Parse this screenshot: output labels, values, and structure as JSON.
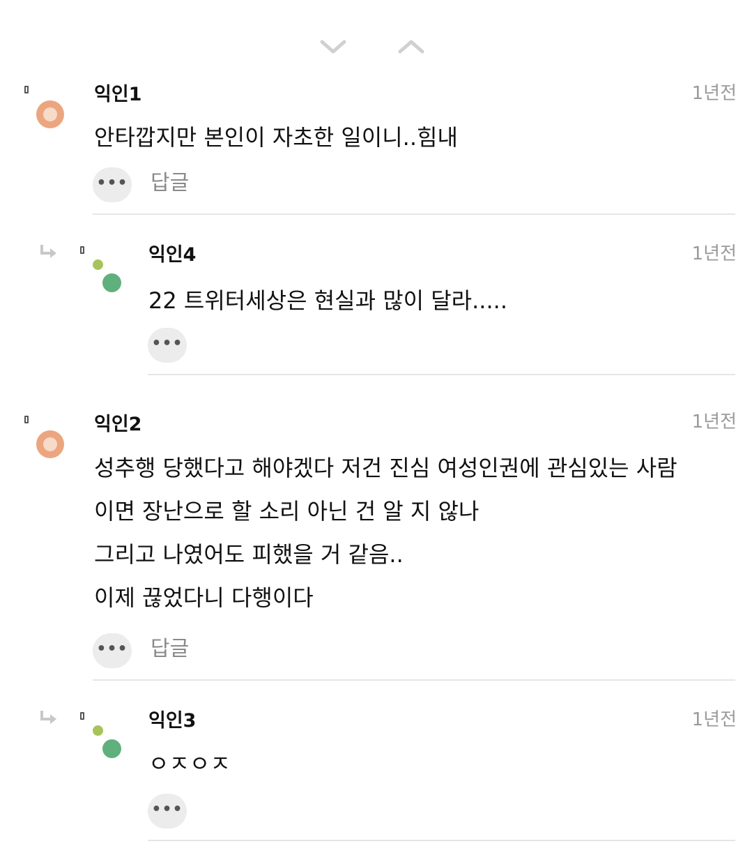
{
  "sort": {
    "down_icon": "chevron-down-icon",
    "up_icon": "chevron-up-icon"
  },
  "comments": [
    {
      "author": "익인1",
      "time": "1년전",
      "lines": [
        "안타깝지만 본인이 자초한 일이니..힘내"
      ],
      "reply_label": "답글"
    },
    {
      "author": "익인4",
      "time": "1년전",
      "lines": [
        "22 트위터세상은 현실과 많이 달라....."
      ]
    },
    {
      "author": "익인2",
      "time": "1년전",
      "lines": [
        "성추행 당했다고 해야겠다 저건 진심 여성인권에 관심있는 사람",
        "이면 장난으로 할 소리 아닌 건 알 지 않나",
        "그리고 나였어도 피했을 거 같음..",
        "이제 끊었다니 다행이다"
      ],
      "reply_label": "답글"
    },
    {
      "author": "익인3",
      "time": "1년전",
      "lines": [
        "ㅇㅈㅇㅈ"
      ]
    }
  ],
  "more_label": "•••",
  "colors": {
    "avatar_orange": "#eba67f",
    "avatar_green": "#5fb07c",
    "avatar_lime": "#a6c45a",
    "time_gray": "#9a9a9a"
  }
}
